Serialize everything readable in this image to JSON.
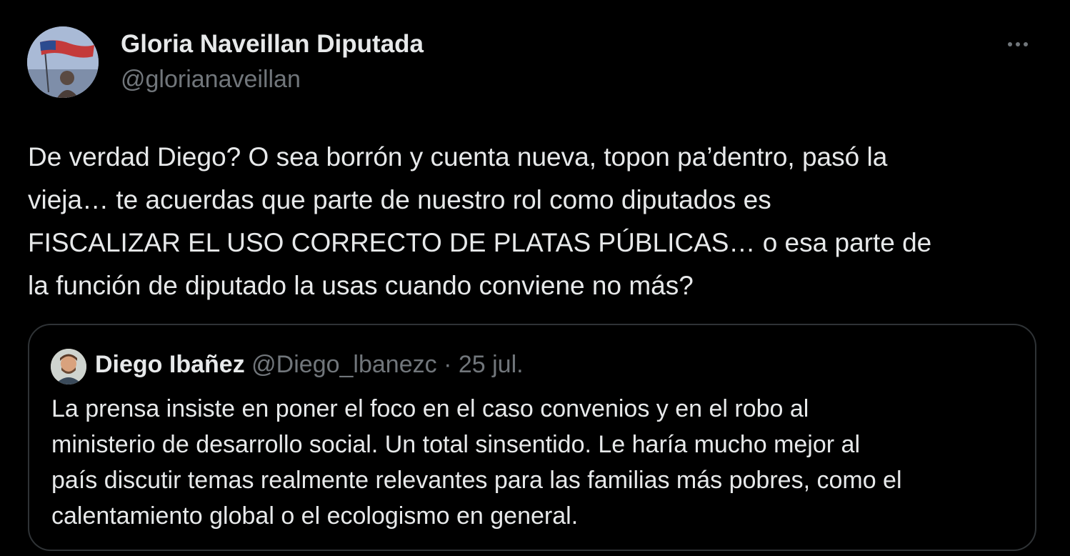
{
  "tweet": {
    "author_name": "Gloria Naveillan Diputada",
    "author_handle": "@glorianaveillan",
    "more_icon": "more-horizontal-icon",
    "text_lines": [
      "De verdad Diego? O sea borrón y cuenta nueva, topon pa’dentro, pasó la",
      "vieja… te acuerdas que parte de nuestro rol como diputados es",
      "FISCALIZAR EL USO CORRECTO DE PLATAS PÚBLICAS… o esa parte de",
      "la función de diputado la usas cuando conviene no más?"
    ]
  },
  "quote": {
    "author_name": "Diego Ibañez",
    "author_handle": "@Diego_lbanezc",
    "separator": "·",
    "date": "25 jul.",
    "text_lines": [
      "La prensa insiste en poner el foco en el caso convenios y en el robo al",
      "ministerio de desarrollo social. Un total sinsentido. Le haría mucho mejor al",
      "país discutir temas realmente relevantes para las familias más pobres, como el",
      "calentamiento global o el ecologismo en general."
    ]
  },
  "colors": {
    "background": "#000000",
    "primary_text": "#e7e9ea",
    "secondary_text": "#71767b",
    "border": "#2f3336"
  }
}
